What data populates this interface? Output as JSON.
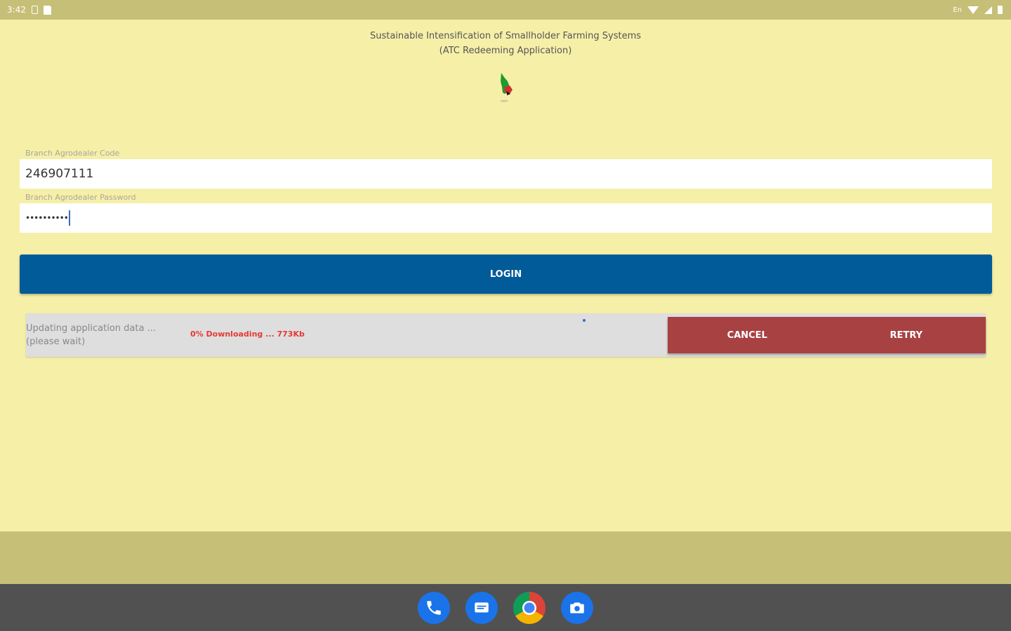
{
  "status_bar": {
    "time": "3:42",
    "language": "En"
  },
  "app": {
    "title_line1": "Sustainable Intensification of Smallholder Farming Systems",
    "title_line2": "(ATC Redeeming Application)"
  },
  "form": {
    "code_label": "Branch Agrodealer Code",
    "code_value": "246907111",
    "password_label": "Branch Agrodealer Password",
    "password_value": "••••••••••",
    "login_label": "LOGIN"
  },
  "update": {
    "status_line1": "Updating application data ...",
    "status_line2": "(please wait)",
    "progress_text": "0% Downloading ... 773Kb",
    "cancel_label": "CANCEL",
    "retry_label": "RETRY"
  },
  "dock": {
    "icons": [
      "phone-icon",
      "messages-icon",
      "chrome-icon",
      "camera-icon"
    ]
  },
  "colors": {
    "background": "#f5efa8",
    "bar": "#c6bf77",
    "login": "#015b98",
    "panel_buttons": "#a84142",
    "progress_text": "#e53935"
  }
}
